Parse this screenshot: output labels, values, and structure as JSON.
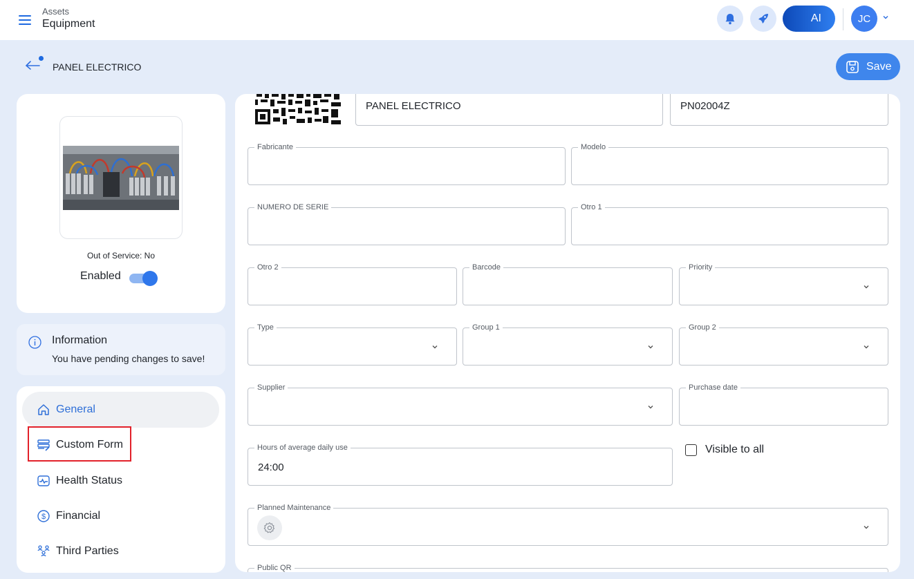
{
  "header": {
    "section": "Assets",
    "title": "Equipment",
    "ai_label": "AI",
    "user_initials": "JC"
  },
  "subheader": {
    "title": "PANEL ELECTRICO",
    "save_label": "Save"
  },
  "asset_card": {
    "out_of_service": "Out of Service: No",
    "enabled_label": "Enabled",
    "enabled": true
  },
  "info": {
    "title": "Information",
    "message": "You have pending changes to save!"
  },
  "nav": {
    "items": [
      {
        "label": "General",
        "icon": "home-icon",
        "active": true
      },
      {
        "label": "Custom Form",
        "icon": "custom-form-icon",
        "active": false
      },
      {
        "label": "Health Status",
        "icon": "health-icon",
        "active": false
      },
      {
        "label": "Financial",
        "icon": "dollar-icon",
        "active": false
      },
      {
        "label": "Third Parties",
        "icon": "third-parties-icon",
        "active": false
      }
    ]
  },
  "form": {
    "name_value": "PANEL ELECTRICO",
    "code_value": "PN02004Z",
    "fabricante": {
      "label": "Fabricante",
      "value": ""
    },
    "modelo": {
      "label": "Modelo",
      "value": ""
    },
    "numero_serie": {
      "label": "NUMERO DE SERIE",
      "value": ""
    },
    "otro1": {
      "label": "Otro 1",
      "value": ""
    },
    "otro2": {
      "label": "Otro 2",
      "value": ""
    },
    "barcode": {
      "label": "Barcode",
      "value": ""
    },
    "priority": {
      "label": "Priority",
      "value": ""
    },
    "type": {
      "label": "Type",
      "value": ""
    },
    "group1": {
      "label": "Group 1",
      "value": ""
    },
    "group2": {
      "label": "Group 2",
      "value": ""
    },
    "supplier": {
      "label": "Supplier",
      "value": ""
    },
    "purchase_date": {
      "label": "Purchase date",
      "value": ""
    },
    "hours_daily_use": {
      "label": "Hours of average daily use",
      "value": "24:00"
    },
    "visible_to_all": {
      "label": "Visible to all",
      "checked": false
    },
    "planned_maintenance": {
      "label": "Planned Maintenance",
      "value": ""
    },
    "public_qr": {
      "label": "Public QR",
      "value": ""
    }
  },
  "colors": {
    "accent": "#3f86ec",
    "background": "#e4ecf9",
    "highlight": "#e2212a"
  }
}
